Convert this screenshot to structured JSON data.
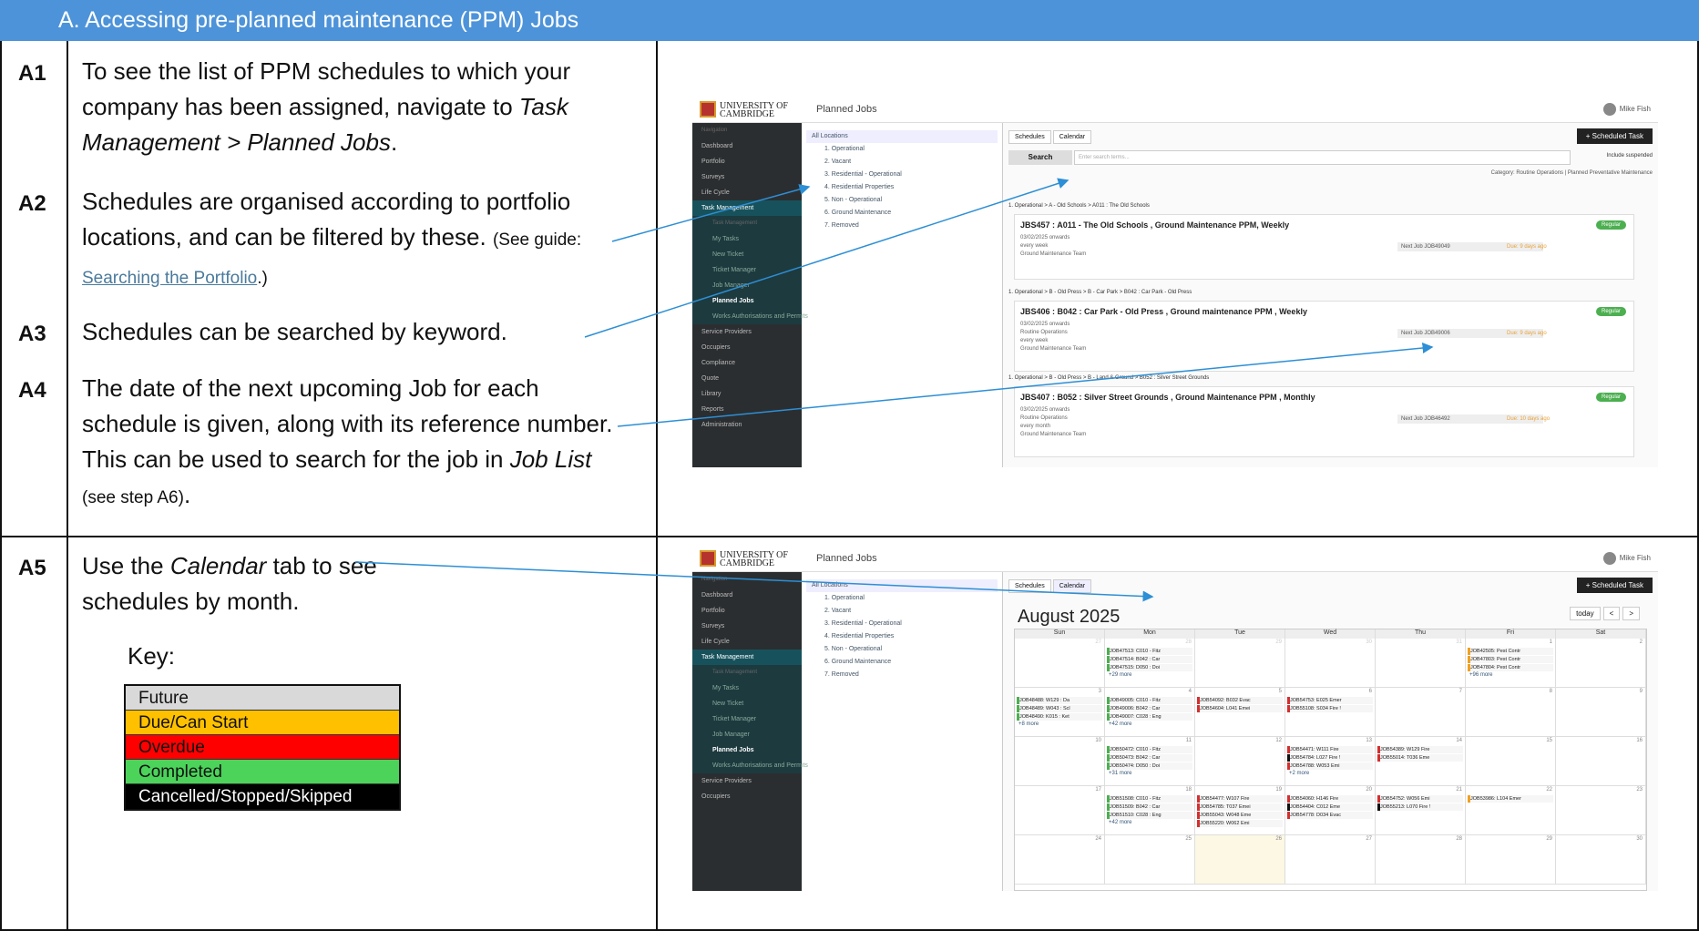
{
  "header": {
    "title": "A.  Accessing pre-planned maintenance (PPM) Jobs"
  },
  "steps": {
    "a1": {
      "label": "A1",
      "text_before": "To see the list of PPM schedules to which your company has been assigned, navigate to ",
      "italic": "Task Management > Planned Jobs",
      "text_after": "."
    },
    "a2": {
      "label": "A2",
      "text": "Schedules are organised according to portfolio locations, and can be filtered by these.",
      "note_before": "(See guide: ",
      "link": "Searching the Portfolio",
      "note_after": ".)"
    },
    "a3": {
      "label": "A3",
      "text": "Schedules can be searched by keyword."
    },
    "a4": {
      "label": "A4",
      "text_before": "The date of the next upcoming Job for each schedule is given, along with its reference number. This can be used to search for the job in ",
      "italic": "Job List",
      "note": "(see step A6)",
      "text_after": "."
    },
    "a5": {
      "label": "A5",
      "text_before": "Use the ",
      "italic": "Calendar",
      "text_after": " tab to see schedules by month."
    }
  },
  "key": {
    "title": "Key:",
    "items": [
      {
        "label": "Future",
        "color": "#d9d9d9",
        "text_color": "#111"
      },
      {
        "label": "Due/Can Start",
        "color": "#ffc000",
        "text_color": "#111"
      },
      {
        "label": "Overdue",
        "color": "#ff0000",
        "text_color": "#111"
      },
      {
        "label": "Completed",
        "color": "#4bd35a",
        "text_color": "#111"
      },
      {
        "label": "Cancelled/Stopped/Skipped",
        "color": "#000000",
        "text_color": "#ffffff"
      }
    ]
  },
  "screenshot1": {
    "logo": "UNIVERSITY OF CAMBRIDGE",
    "page_title": "Planned Jobs",
    "user": "Mike Fish",
    "nav": [
      "Navigation",
      "Dashboard",
      "Portfolio",
      "Surveys",
      "Life Cycle",
      "Task Management",
      "Task Management",
      "My Tasks",
      "New Ticket",
      "Ticket Manager",
      "Job Manager",
      "Planned Jobs",
      "Works Authorisations and Permits",
      "Service Providers",
      "Occupiers",
      "Compliance",
      "Quote",
      "Library",
      "Reports",
      "Administration"
    ],
    "tree": [
      "All Locations",
      "1. Operational",
      "2. Vacant",
      "3. Residential - Operational",
      "4. Residential Properties",
      "5. Non - Operational",
      "6. Ground Maintenance",
      "7. Removed"
    ],
    "tabs": [
      "Schedules",
      "Calendar"
    ],
    "scheduled_task": "+ Scheduled Task",
    "search_button": "Search",
    "search_placeholder": "Enter search terms...",
    "include_suspended": "Include suspended",
    "category": "Category:  Routine Operations  |  Planned Preventative Maintenance",
    "cards": [
      {
        "crumb": "1. Operational > A - Old Schools > A011 : The Old Schools",
        "title": "JBS457 : A011 - The Old Schools , Ground Maintenance PPM, Weekly",
        "lines": [
          "03/02/2025 onwards",
          "every week",
          "Ground Maintenance Team"
        ],
        "next": "Next Job  JOB49049",
        "due": "Due: 9 days ago",
        "badge": "Regular"
      },
      {
        "crumb": "1. Operational > B - Old Press > B - Car Park > B042 : Car Park - Old Press",
        "title": "JBS406 : B042 : Car Park - Old Press , Ground maintenance PPM , Weekly",
        "lines": [
          "03/02/2025 onwards",
          "Routine Operations",
          "every week",
          "Ground Maintenance Team"
        ],
        "next": "Next Job  JOB49006",
        "due": "Due: 9 days ago",
        "badge": "Regular"
      },
      {
        "crumb": "1. Operational > B - Old Press > B - Land & Ground > B052 : Silver Street Grounds",
        "title": "JBS407 : B052 : Silver Street Grounds , Ground Maintenance PPM , Monthly",
        "lines": [
          "03/02/2025 onwards",
          "Routine Operations",
          "every month",
          "Ground Maintenance Team"
        ],
        "next": "Next Job  JOB46492",
        "due": "Due: 10 days ago",
        "badge": "Regular"
      }
    ]
  },
  "screenshot2": {
    "logo": "UNIVERSITY OF CAMBRIDGE",
    "page_title": "Planned Jobs",
    "user": "Mike Fish",
    "nav": [
      "Navigation",
      "Dashboard",
      "Portfolio",
      "Surveys",
      "Life Cycle",
      "Task Management",
      "Task Management",
      "My Tasks",
      "New Ticket",
      "Ticket Manager",
      "Job Manager",
      "Planned Jobs",
      "Works Authorisations and Permits",
      "Service Providers",
      "Occupiers"
    ],
    "tree": [
      "All Locations",
      "1. Operational",
      "2. Vacant",
      "3. Residential - Operational",
      "4. Residential Properties",
      "5. Non - Operational",
      "6. Ground Maintenance",
      "7. Removed"
    ],
    "tabs": [
      "Schedules",
      "Calendar"
    ],
    "scheduled_task": "+ Scheduled Task",
    "month": "August 2025",
    "today": "today",
    "days": [
      "Sun",
      "Mon",
      "Tue",
      "Wed",
      "Thu",
      "Fri",
      "Sat"
    ],
    "weeks": [
      {
        "dates": [
          "27",
          "28",
          "29",
          "30",
          "31",
          "1",
          "2"
        ],
        "events": {
          "1": [
            [
              "g",
              "JOB47513: C010 - Fitz"
            ],
            [
              "g",
              "JOB47514: B042 : Car"
            ],
            [
              "g",
              "JOB47515: D050 : Doi"
            ]
          ],
          "5": [
            [
              "o",
              "JOB42505: Pest Contr"
            ],
            [
              "o",
              "JOB47803: Pest Contr"
            ],
            [
              "o",
              "JOB47804: Pest Contr"
            ]
          ]
        },
        "more": {
          "1": "+29 more",
          "5": "+96 more"
        }
      },
      {
        "dates": [
          "3",
          "4",
          "5",
          "6",
          "7",
          "8",
          "9"
        ],
        "events": {
          "0": [
            [
              "g",
              "JOB48488: W129 : Da"
            ],
            [
              "g",
              "JOB48489: W043 : Scl"
            ],
            [
              "g",
              "JOB48490: K015 : Ket"
            ]
          ],
          "1": [
            [
              "g",
              "JOB49005: C010 - Fitz"
            ],
            [
              "g",
              "JOB49006: B042 : Car"
            ],
            [
              "g",
              "JOB49007: C028 : Eng"
            ]
          ],
          "2": [
            [
              "r",
              "JOB54092: B032 Evac"
            ],
            [
              "r",
              "JOB54604: L041 Emei"
            ]
          ],
          "3": [
            [
              "r",
              "JOB54753: E025 Emer"
            ],
            [
              "r",
              "JOB55108: S034 Fire !"
            ]
          ]
        },
        "more": {
          "0": "+8 more",
          "1": "+42 more"
        }
      },
      {
        "dates": [
          "10",
          "11",
          "12",
          "13",
          "14",
          "15",
          "16"
        ],
        "events": {
          "1": [
            [
              "g",
              "JOB50472: C010 - Fitz"
            ],
            [
              "g",
              "JOB50473: B042 : Car"
            ],
            [
              "g",
              "JOB50474: D050 : Doi"
            ]
          ],
          "3": [
            [
              "r",
              "JOB54471: W111 Fire"
            ],
            [
              "k",
              "JOB54784: L027 Fire !"
            ],
            [
              "r",
              "JOB54788: W053 Emi"
            ]
          ],
          "4": [
            [
              "r",
              "JOB54389: W129 Fire"
            ],
            [
              "r",
              "JOB55014: T036 Eme"
            ]
          ]
        },
        "more": {
          "1": "+31 more",
          "3": "+2 more"
        }
      },
      {
        "dates": [
          "17",
          "18",
          "19",
          "20",
          "21",
          "22",
          "23"
        ],
        "events": {
          "1": [
            [
              "g",
              "JOB51508: C010 - Fitz"
            ],
            [
              "g",
              "JOB51509: B042 : Car"
            ],
            [
              "g",
              "JOB51510: C028 : Eng"
            ]
          ],
          "2": [
            [
              "r",
              "JOB54477: W107 Fire"
            ],
            [
              "r",
              "JOB54785: T037 Emei"
            ],
            [
              "r",
              "JOB55043: W048 Eme"
            ],
            [
              "r",
              "JOB55220: W062 Emi"
            ]
          ],
          "3": [
            [
              "r",
              "JOB54060: H146 Fire"
            ],
            [
              "k",
              "JOB54404: C012 Eme"
            ],
            [
              "r",
              "JOB54778: D034 Evac"
            ]
          ],
          "4": [
            [
              "r",
              "JOB54752: W056 Emi"
            ],
            [
              "k",
              "JOB55213: L070 Fire !"
            ]
          ],
          "5": [
            [
              "o",
              "JOB53986: L104 Emer"
            ]
          ]
        },
        "more": {
          "1": "+42 more"
        }
      },
      {
        "dates": [
          "24",
          "25",
          "26",
          "27",
          "28",
          "29",
          "30"
        ],
        "events": {},
        "more": {}
      }
    ]
  }
}
